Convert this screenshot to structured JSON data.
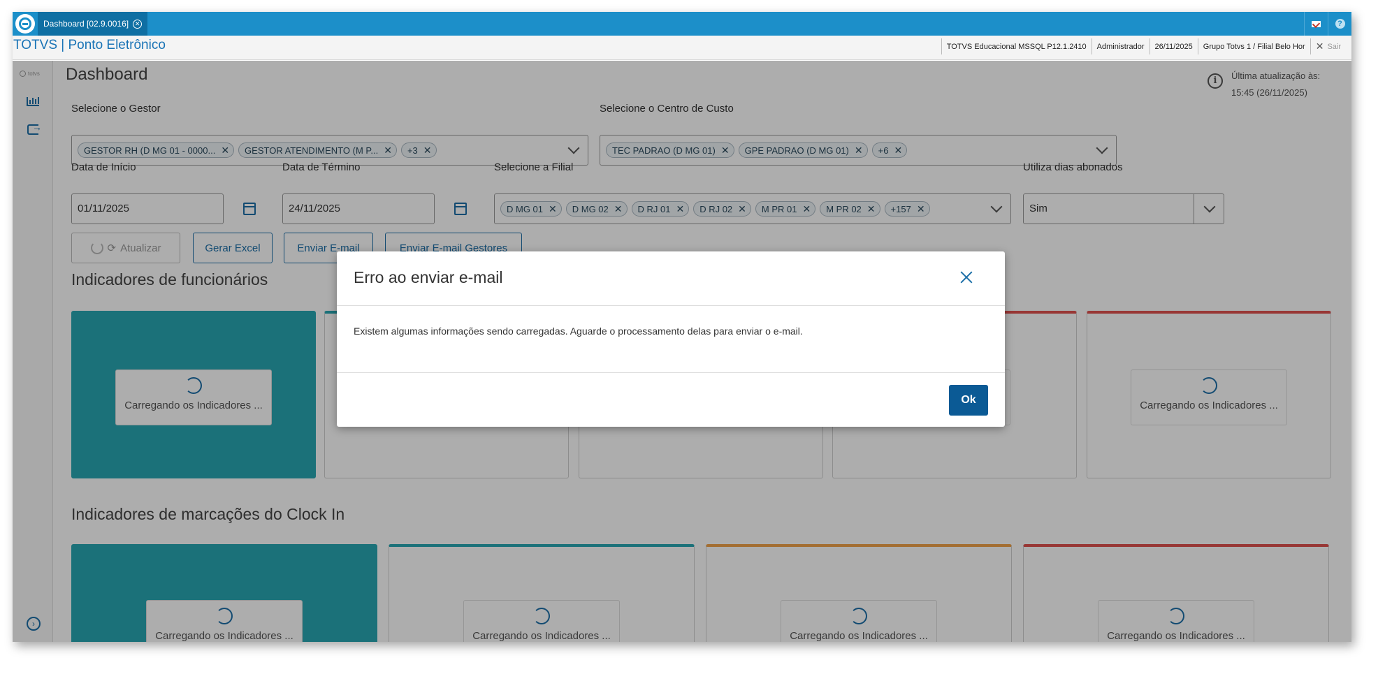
{
  "tab": {
    "label": "Dashboard [02.9.0016]"
  },
  "header": {
    "product_title": "TOTVS | Ponto Eletrônico",
    "environment": "TOTVS Educacional MSSQL P12.1.2410",
    "user": "Administrador",
    "date": "26/11/2025",
    "branch": "Grupo Totvs 1 / Filial Belo Hor",
    "exit_label": "Sair"
  },
  "rail": {
    "logo_text": "totvs"
  },
  "page": {
    "title": "Dashboard",
    "last_update_label": "Última atualização às:",
    "last_update_value": "15:45 (26/11/2025)"
  },
  "filters": {
    "gestor": {
      "label": "Selecione o Gestor",
      "chips": [
        "GESTOR RH (D MG 01 - 0000...",
        "GESTOR ATENDIMENTO (M P...",
        "+3"
      ]
    },
    "centro_custo": {
      "label": "Selecione o Centro de Custo",
      "chips": [
        "TEC PADRAO (D MG 01)",
        "GPE PADRAO (D MG 01)",
        "+6"
      ]
    },
    "data_inicio": {
      "label": "Data de Início",
      "value": "01/11/2025"
    },
    "data_termino": {
      "label": "Data de Término",
      "value": "24/11/2025"
    },
    "filial": {
      "label": "Selecione a Filial",
      "chips": [
        "D MG 01",
        "D MG 02",
        "D RJ 01",
        "D RJ 02",
        "M PR 01",
        "M PR 02",
        "+157"
      ]
    },
    "dias_abonados": {
      "label": "Utiliza dias abonados",
      "value": "Sim"
    }
  },
  "actions": {
    "atualizar": "Atualizar",
    "gerar_excel": "Gerar Excel",
    "enviar_email": "Enviar E-mail",
    "enviar_email_gestores": "Enviar E-mail Gestores"
  },
  "sections": {
    "funcionarios_title": "Indicadores de funcionários",
    "clockin_title": "Indicadores de marcações do Clock In",
    "loading_text": "Carregando os Indicadores ..."
  },
  "modal": {
    "title": "Erro ao enviar e-mail",
    "message": "Existem algumas informações sendo carregadas. Aguarde o processamento delas para enviar o e-mail.",
    "ok_label": "Ok"
  },
  "colors": {
    "brand_blue": "#1c8fc9",
    "teal_card": "#29a7b3",
    "orange_accent": "#f0a34a",
    "red_accent": "#e0524f",
    "ok_button": "#0b5a95"
  }
}
